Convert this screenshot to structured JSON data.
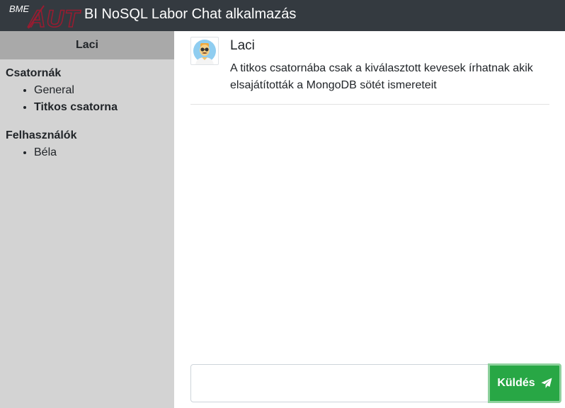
{
  "header": {
    "logo_text_bme": "BME",
    "logo_text_aut": "AUT",
    "title": "BI NoSQL Labor Chat alkalmazás"
  },
  "sidebar": {
    "current_user": "Laci",
    "channels": {
      "title": "Csatornák",
      "items": [
        {
          "label": "General",
          "active": false
        },
        {
          "label": "Titkos csatorna",
          "active": true
        }
      ]
    },
    "users": {
      "title": "Felhasználók",
      "items": [
        {
          "label": "Béla"
        }
      ]
    }
  },
  "messages": [
    {
      "author": "Laci",
      "text": "A titkos csatornába csak a kiválasztott kevesek írhatnak akik elsajátították a MongoDB sötét ismereteit",
      "avatar_icon": "user-avatar-icon"
    }
  ],
  "composer": {
    "input_value": "",
    "send_label": "Küldés",
    "send_icon": "paper-plane-icon"
  },
  "colors": {
    "navbar": "#343a40",
    "sidebar": "#d3d3d3",
    "sidebar_header": "#a9a9a9",
    "send_button": "#28a745",
    "logo_red": "#9b1b30"
  }
}
